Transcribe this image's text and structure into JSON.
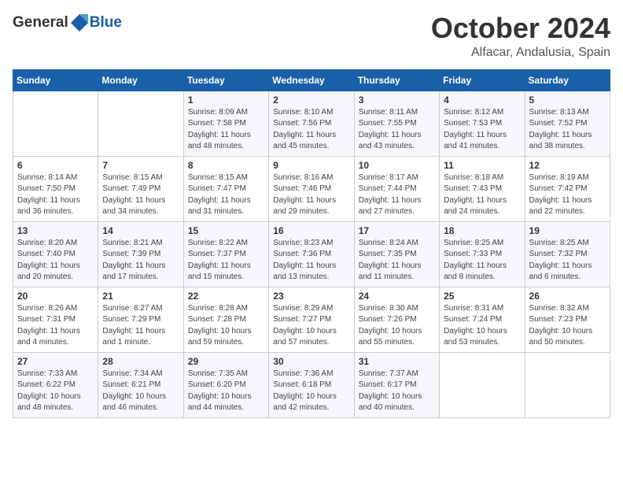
{
  "header": {
    "logo_general": "General",
    "logo_blue": "Blue",
    "month": "October 2024",
    "location": "Alfacar, Andalusia, Spain"
  },
  "weekdays": [
    "Sunday",
    "Monday",
    "Tuesday",
    "Wednesday",
    "Thursday",
    "Friday",
    "Saturday"
  ],
  "weeks": [
    [
      null,
      null,
      {
        "day": 1,
        "sunrise": "8:09 AM",
        "sunset": "7:58 PM",
        "daylight": "11 hours and 48 minutes."
      },
      {
        "day": 2,
        "sunrise": "8:10 AM",
        "sunset": "7:56 PM",
        "daylight": "11 hours and 45 minutes."
      },
      {
        "day": 3,
        "sunrise": "8:11 AM",
        "sunset": "7:55 PM",
        "daylight": "11 hours and 43 minutes."
      },
      {
        "day": 4,
        "sunrise": "8:12 AM",
        "sunset": "7:53 PM",
        "daylight": "11 hours and 41 minutes."
      },
      {
        "day": 5,
        "sunrise": "8:13 AM",
        "sunset": "7:52 PM",
        "daylight": "11 hours and 38 minutes."
      }
    ],
    [
      {
        "day": 6,
        "sunrise": "8:14 AM",
        "sunset": "7:50 PM",
        "daylight": "11 hours and 36 minutes."
      },
      {
        "day": 7,
        "sunrise": "8:15 AM",
        "sunset": "7:49 PM",
        "daylight": "11 hours and 34 minutes."
      },
      {
        "day": 8,
        "sunrise": "8:15 AM",
        "sunset": "7:47 PM",
        "daylight": "11 hours and 31 minutes."
      },
      {
        "day": 9,
        "sunrise": "8:16 AM",
        "sunset": "7:46 PM",
        "daylight": "11 hours and 29 minutes."
      },
      {
        "day": 10,
        "sunrise": "8:17 AM",
        "sunset": "7:44 PM",
        "daylight": "11 hours and 27 minutes."
      },
      {
        "day": 11,
        "sunrise": "8:18 AM",
        "sunset": "7:43 PM",
        "daylight": "11 hours and 24 minutes."
      },
      {
        "day": 12,
        "sunrise": "8:19 AM",
        "sunset": "7:42 PM",
        "daylight": "11 hours and 22 minutes."
      }
    ],
    [
      {
        "day": 13,
        "sunrise": "8:20 AM",
        "sunset": "7:40 PM",
        "daylight": "11 hours and 20 minutes."
      },
      {
        "day": 14,
        "sunrise": "8:21 AM",
        "sunset": "7:39 PM",
        "daylight": "11 hours and 17 minutes."
      },
      {
        "day": 15,
        "sunrise": "8:22 AM",
        "sunset": "7:37 PM",
        "daylight": "11 hours and 15 minutes."
      },
      {
        "day": 16,
        "sunrise": "8:23 AM",
        "sunset": "7:36 PM",
        "daylight": "11 hours and 13 minutes."
      },
      {
        "day": 17,
        "sunrise": "8:24 AM",
        "sunset": "7:35 PM",
        "daylight": "11 hours and 11 minutes."
      },
      {
        "day": 18,
        "sunrise": "8:25 AM",
        "sunset": "7:33 PM",
        "daylight": "11 hours and 8 minutes."
      },
      {
        "day": 19,
        "sunrise": "8:25 AM",
        "sunset": "7:32 PM",
        "daylight": "11 hours and 6 minutes."
      }
    ],
    [
      {
        "day": 20,
        "sunrise": "8:26 AM",
        "sunset": "7:31 PM",
        "daylight": "11 hours and 4 minutes."
      },
      {
        "day": 21,
        "sunrise": "8:27 AM",
        "sunset": "7:29 PM",
        "daylight": "11 hours and 1 minute."
      },
      {
        "day": 22,
        "sunrise": "8:28 AM",
        "sunset": "7:28 PM",
        "daylight": "10 hours and 59 minutes."
      },
      {
        "day": 23,
        "sunrise": "8:29 AM",
        "sunset": "7:27 PM",
        "daylight": "10 hours and 57 minutes."
      },
      {
        "day": 24,
        "sunrise": "8:30 AM",
        "sunset": "7:26 PM",
        "daylight": "10 hours and 55 minutes."
      },
      {
        "day": 25,
        "sunrise": "8:31 AM",
        "sunset": "7:24 PM",
        "daylight": "10 hours and 53 minutes."
      },
      {
        "day": 26,
        "sunrise": "8:32 AM",
        "sunset": "7:23 PM",
        "daylight": "10 hours and 50 minutes."
      }
    ],
    [
      {
        "day": 27,
        "sunrise": "7:33 AM",
        "sunset": "6:22 PM",
        "daylight": "10 hours and 48 minutes."
      },
      {
        "day": 28,
        "sunrise": "7:34 AM",
        "sunset": "6:21 PM",
        "daylight": "10 hours and 46 minutes."
      },
      {
        "day": 29,
        "sunrise": "7:35 AM",
        "sunset": "6:20 PM",
        "daylight": "10 hours and 44 minutes."
      },
      {
        "day": 30,
        "sunrise": "7:36 AM",
        "sunset": "6:18 PM",
        "daylight": "10 hours and 42 minutes."
      },
      {
        "day": 31,
        "sunrise": "7:37 AM",
        "sunset": "6:17 PM",
        "daylight": "10 hours and 40 minutes."
      },
      null,
      null
    ]
  ],
  "labels": {
    "sunrise": "Sunrise:",
    "sunset": "Sunset:",
    "daylight": "Daylight:"
  }
}
